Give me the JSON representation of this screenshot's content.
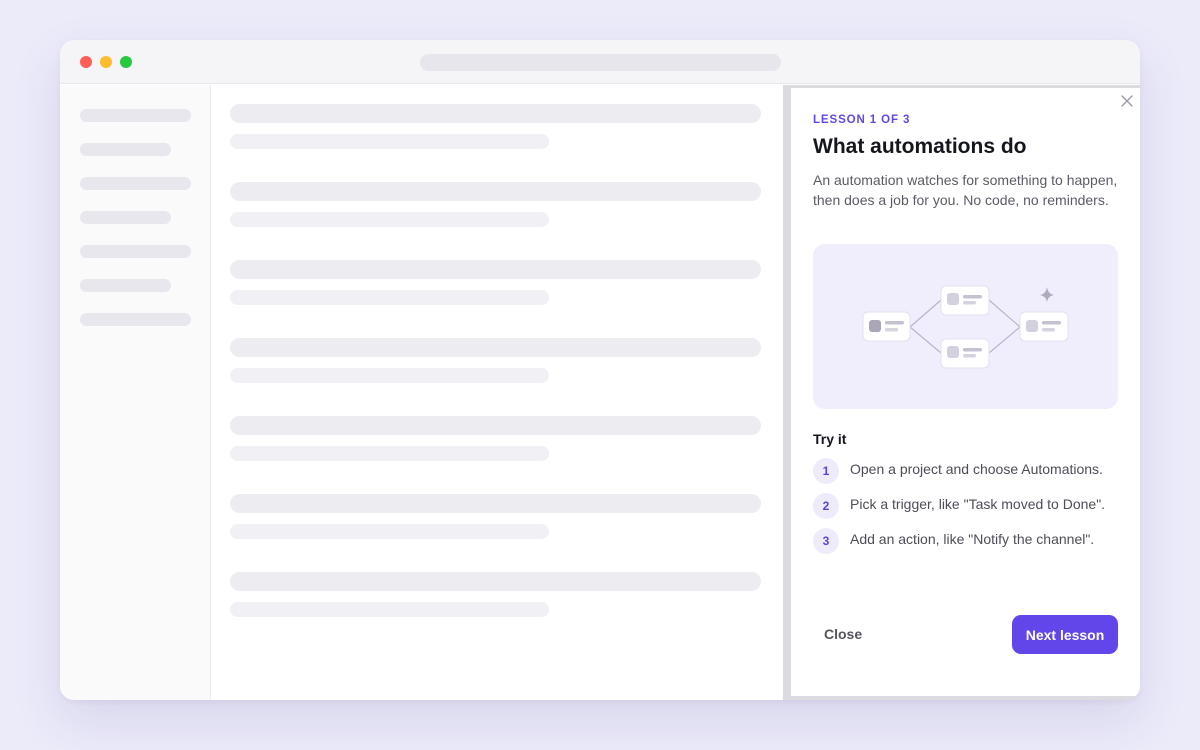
{
  "lesson_panel": {
    "eyebrow": "LESSON 1 OF 3",
    "title": "What automations do",
    "description": "An automation watches for something to happen, then does a job for you. No code, no reminders.",
    "try_it_heading": "Try it",
    "steps": [
      {
        "number": "1",
        "text": "Open a project and choose Automations."
      },
      {
        "number": "2",
        "text": "Pick a trigger, like \"Task moved to Done\"."
      },
      {
        "number": "3",
        "text": "Add an action, like \"Notify the channel\"."
      }
    ],
    "close_icon": "close-icon",
    "close_label": "Close",
    "next_label": "Next lesson"
  },
  "colors": {
    "accent": "#6246ea",
    "eyebrow": "#6347e6",
    "background": "#ecebfa",
    "illustration_bg": "#f0eefc"
  }
}
